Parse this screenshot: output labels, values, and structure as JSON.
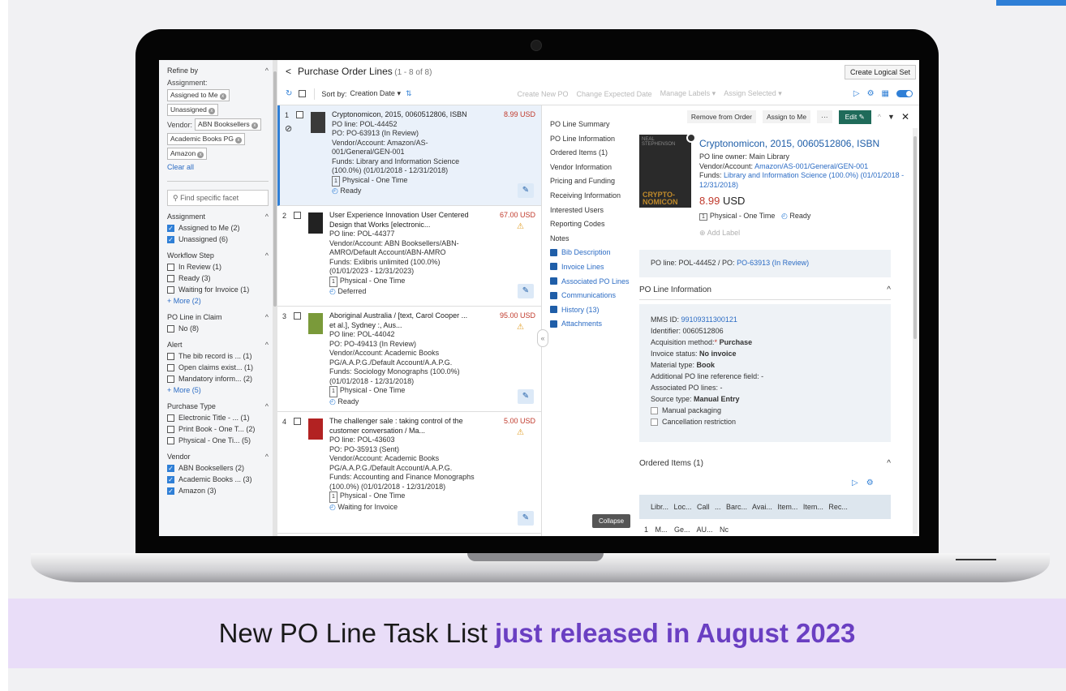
{
  "banner": {
    "lead": "New PO Line Task List",
    "highlight": "just released in August 2023"
  },
  "facets": {
    "refine_by": "Refine by",
    "assignment_label": "Assignment:",
    "assignment_chips": [
      "Assigned to Me",
      "Unassigned"
    ],
    "vendor_label": "Vendor:",
    "vendor_chips": [
      "ABN Booksellers",
      "Academic Books PG",
      "Amazon"
    ],
    "clear_all": "Clear all",
    "search_placeholder": "Find specific facet",
    "groups": [
      {
        "title": "Assignment",
        "items": [
          {
            "label": "Assigned to Me (2)",
            "checked": true
          },
          {
            "label": "Unassigned (6)",
            "checked": true
          }
        ]
      },
      {
        "title": "Workflow Step",
        "items": [
          {
            "label": "In Review (1)",
            "checked": false
          },
          {
            "label": "Ready (3)",
            "checked": false
          },
          {
            "label": "Waiting for Invoice (1)",
            "checked": false
          }
        ],
        "more": "+ More (2)"
      },
      {
        "title": "PO Line in Claim",
        "items": [
          {
            "label": "No (8)",
            "checked": false
          }
        ]
      },
      {
        "title": "Alert",
        "items": [
          {
            "label": "The bib record is ...   (1)",
            "checked": false
          },
          {
            "label": "Open claims exist...  (1)",
            "checked": false
          },
          {
            "label": "Mandatory inform...  (2)",
            "checked": false
          }
        ],
        "more": "+ More (5)"
      },
      {
        "title": "Purchase Type",
        "items": [
          {
            "label": "Electronic Title - ...  (1)",
            "checked": false
          },
          {
            "label": "Print Book - One T... (2)",
            "checked": false
          },
          {
            "label": "Physical - One Ti...   (5)",
            "checked": false
          }
        ]
      },
      {
        "title": "Vendor",
        "items": [
          {
            "label": "ABN Booksellers (2)",
            "checked": true
          },
          {
            "label": "Academic Books ...  (3)",
            "checked": true
          },
          {
            "label": "Amazon (3)",
            "checked": true
          }
        ]
      }
    ]
  },
  "header": {
    "back": "<",
    "title": "Purchase Order Lines",
    "count": "(1 - 8 of 8)",
    "create_logical_set": "Create Logical Set"
  },
  "toolbar": {
    "sort_label": "Sort by:",
    "sort_value": "Creation Date",
    "actions": [
      "Create New PO",
      "Change Expected Date",
      "Manage Labels ▾",
      "Assign Selected ▾"
    ]
  },
  "rows": [
    {
      "num": "1",
      "title": "Cryptonomicon, 2015, 0060512806, ISBN",
      "price": "8.99 USD",
      "lines": [
        "PO line: POL-44452",
        "PO: PO-63913 (In Review)",
        "Vendor/Account: Amazon/AS-",
        "001/General/GEN-001",
        "Funds: Library and Information Science",
        "(100.0%) (01/01/2018 - 12/31/2018)"
      ],
      "type": "Physical - One Time",
      "status": "Ready"
    },
    {
      "num": "2",
      "title": "User Experience Innovation User Centered",
      "title2": "Design that Works [electronic...",
      "price": "67.00 USD",
      "lines": [
        "PO line: POL-44377",
        "Vendor/Account: ABN Booksellers/ABN-",
        "AMRO/Default Account/ABN-AMRO",
        "Funds: Exlibris unlimited (100.0%)",
        "(01/01/2023 - 12/31/2023)"
      ],
      "type": "Physical - One Time",
      "status": "Deferred"
    },
    {
      "num": "3",
      "title": "Aboriginal Australia / [text, Carol Cooper ...",
      "title2": "et al.], Sydney :, Aus...",
      "price": "95.00 USD",
      "lines": [
        "PO line: POL-44042",
        "PO: PO-49413 (In Review)",
        "Vendor/Account: Academic Books",
        "PG/A.A.P.G./Default Account/A.A.P.G.",
        "Funds: Sociology Monographs (100.0%)",
        "(01/01/2018 - 12/31/2018)"
      ],
      "type": "Physical - One Time",
      "status": "Ready"
    },
    {
      "num": "4",
      "title": "The challenger sale : taking control of the",
      "title2": "customer conversation / Ma...",
      "price": "5.00 USD",
      "lines": [
        "PO line: POL-43603",
        "PO: PO-35913 (Sent)",
        "Vendor/Account: Academic Books",
        "PG/A.A.P.G./Default Account/A.A.P.G.",
        "Funds: Accounting and Finance Monographs",
        "(100.0%) (01/01/2018 - 12/31/2018)"
      ],
      "type": "Physical - One Time",
      "status": "Waiting for Invoice"
    }
  ],
  "type_badge": "1",
  "nav": {
    "items": [
      "PO Line Summary",
      "PO Line Information",
      "Ordered Items (1)",
      "Vendor Information",
      "Pricing and Funding",
      "Receiving Information",
      "Interested Users",
      "Reporting Codes",
      "Notes"
    ],
    "icon_items": [
      "Bib Description",
      "Invoice Lines",
      "Associated PO Lines",
      "Communications",
      "History (13)",
      "Attachments"
    ],
    "collapse": "Collapse",
    "handle": "«"
  },
  "detail": {
    "remove": "Remove from Order",
    "assign": "Assign to Me",
    "more": "···",
    "edit": "Edit",
    "close": "✕",
    "cover_author": "NEAL STEPHENSON",
    "cover_title": "CRYPTO-NOMICON",
    "title": "Cryptonomicon, 2015, 0060512806, ISBN",
    "owner": "PO line owner: Main Library",
    "vendor_label": "Vendor/Account:",
    "vendor_value": "Amazon/AS-001/General/GEN-001",
    "funds_label": "Funds:",
    "funds_value": "Library and Information Science (100.0%) (01/01/2018 - 12/31/2018)",
    "price": "8.99",
    "currency": "USD",
    "purchase_type": "Physical - One Time",
    "status": "Ready",
    "add_label": "Add Label",
    "poline_label": "PO line: POL-44452 / PO:",
    "po_link": "PO-63913",
    "po_state": "(In Review)",
    "info_header": "PO Line Information",
    "mms_label": "MMS ID:",
    "mms_value": "99109311300121",
    "identifier": "Identifier: 0060512806",
    "acq_label": "Acquisition method:",
    "acq_value": "Purchase",
    "inv_label": "Invoice status:",
    "inv_value": "No invoice",
    "mat_label": "Material type:",
    "mat_value": "Book",
    "addl": "Additional PO line reference field: -",
    "assoc": "Associated PO lines: -",
    "src_label": "Source type:",
    "src_value": "Manual Entry",
    "manual_packaging": "Manual packaging",
    "cancel_restriction": "Cancellation restriction",
    "ordered_header": "Ordered Items (1)",
    "table_header": "Libr... Loc... Call ... Barc... Avai... Item... Item... Rec...",
    "table_row": "1  M...  Ge...  AU...  Nc"
  }
}
